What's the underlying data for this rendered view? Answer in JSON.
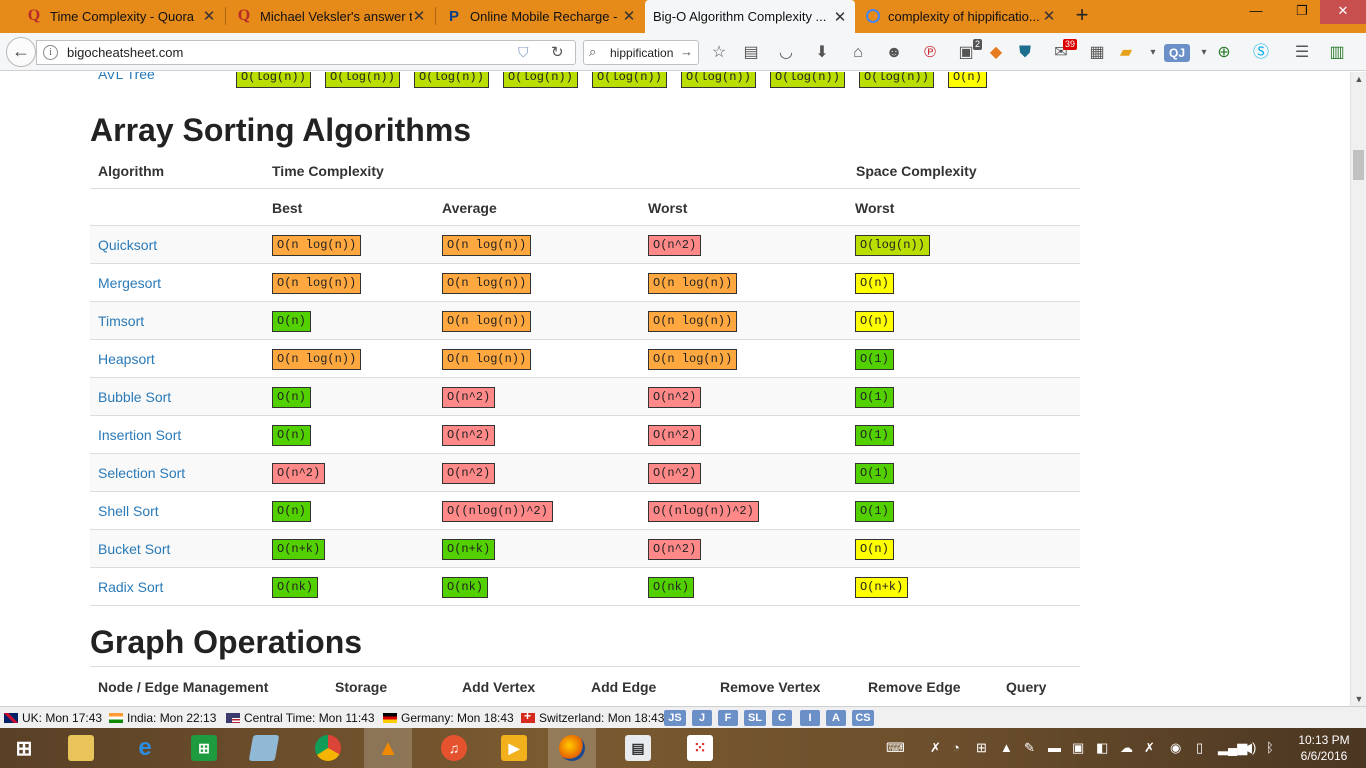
{
  "browser": {
    "tabs": [
      {
        "icon": "Q",
        "title": "Time Complexity - Quora",
        "active": false
      },
      {
        "icon": "Q",
        "title": "Michael Veksler's answer t...",
        "active": false
      },
      {
        "icon": "P",
        "title": "Online Mobile Recharge - ...",
        "active": false
      },
      {
        "icon": "",
        "title": "Big-O Algorithm Complexity ...",
        "active": true
      },
      {
        "icon": "G",
        "title": "complexity of hippificatio...",
        "active": false
      }
    ],
    "url": "bigocheatsheet.com",
    "search_value": "hippification",
    "badges": {
      "ext1": "2",
      "ext2": "39"
    },
    "toolbar_text": {
      "qj": "QJ"
    }
  },
  "avl_tree": {
    "name": "AVL Tree",
    "values": [
      "O(log(n))",
      "O(log(n))",
      "O(log(n))",
      "O(log(n))",
      "O(log(n))",
      "O(log(n))",
      "O(log(n))",
      "O(log(n))",
      "O(n)"
    ],
    "colors": [
      "#bade00",
      "#bade00",
      "#bade00",
      "#bade00",
      "#bade00",
      "#bade00",
      "#bade00",
      "#bade00",
      "#ffff00"
    ]
  },
  "sorting": {
    "title": "Array Sorting Algorithms",
    "headers": {
      "algorithm": "Algorithm",
      "time": "Time Complexity",
      "space": "Space Complexity",
      "best": "Best",
      "average": "Average",
      "worst": "Worst",
      "space_worst": "Worst"
    },
    "rows": [
      {
        "name": "Quicksort",
        "best": "O(n log(n))",
        "average": "O(n log(n))",
        "worst": "O(n^2)",
        "space": "O(log(n))"
      },
      {
        "name": "Mergesort",
        "best": "O(n log(n))",
        "average": "O(n log(n))",
        "worst": "O(n log(n))",
        "space": "O(n)"
      },
      {
        "name": "Timsort",
        "best": "O(n)",
        "average": "O(n log(n))",
        "worst": "O(n log(n))",
        "space": "O(n)"
      },
      {
        "name": "Heapsort",
        "best": "O(n log(n))",
        "average": "O(n log(n))",
        "worst": "O(n log(n))",
        "space": "O(1)"
      },
      {
        "name": "Bubble Sort",
        "best": "O(n)",
        "average": "O(n^2)",
        "worst": "O(n^2)",
        "space": "O(1)"
      },
      {
        "name": "Insertion Sort",
        "best": "O(n)",
        "average": "O(n^2)",
        "worst": "O(n^2)",
        "space": "O(1)"
      },
      {
        "name": "Selection Sort",
        "best": "O(n^2)",
        "average": "O(n^2)",
        "worst": "O(n^2)",
        "space": "O(1)"
      },
      {
        "name": "Shell Sort",
        "best": "O(n)",
        "average": "O((nlog(n))^2)",
        "worst": "O((nlog(n))^2)",
        "space": "O(1)"
      },
      {
        "name": "Bucket Sort",
        "best": "O(n+k)",
        "average": "O(n+k)",
        "worst": "O(n^2)",
        "space": "O(n)"
      },
      {
        "name": "Radix Sort",
        "best": "O(nk)",
        "average": "O(nk)",
        "worst": "O(nk)",
        "space": "O(n+k)"
      }
    ],
    "colors": {
      "O(1)": "#53d000",
      "O(n)": "#ffff00",
      "O(log(n))": "#bade00",
      "O(n log(n))": "#ffa83f",
      "O(n^2)": "#ff8989",
      "O((nlog(n))^2)": "#ff8989",
      "O(n+k)": "#53d000",
      "O(nk)": "#53d000"
    },
    "cell_color_overrides": {
      "Timsort.best": "#53d000",
      "Bubble Sort.best": "#53d000",
      "Insertion Sort.best": "#53d000",
      "Shell Sort.best": "#53d000",
      "Mergesort.space": "#ffff00",
      "Timsort.space": "#ffff00",
      "Bucket Sort.space": "#ffff00",
      "Radix Sort.space": "#ffff00"
    }
  },
  "graph": {
    "title": "Graph Operations",
    "headers": [
      "Node / Edge Management",
      "Storage",
      "Add Vertex",
      "Add Edge",
      "Remove Vertex",
      "Remove Edge",
      "Query"
    ]
  },
  "statusbar": {
    "clocks": [
      {
        "flag": "uk",
        "label": "UK: Mon 17:43"
      },
      {
        "flag": "in",
        "label": "India: Mon 22:13"
      },
      {
        "flag": "us",
        "label": "Central Time: Mon 11:43"
      },
      {
        "flag": "de",
        "label": "Germany: Mon 18:43"
      },
      {
        "flag": "ch",
        "label": "Switzerland: Mon 18:43"
      }
    ],
    "buttons": [
      "JS",
      "J",
      "F",
      "SL",
      "C",
      "I",
      "A",
      "CS"
    ]
  },
  "taskbar": {
    "time": "10:13 PM",
    "date": "6/6/2016"
  }
}
